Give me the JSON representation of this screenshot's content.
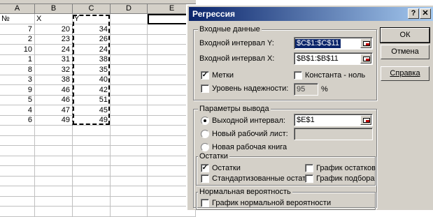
{
  "sheet": {
    "columns": [
      "A",
      "B",
      "C",
      "D",
      "E"
    ],
    "headers": {
      "a": "№",
      "b": "X",
      "c": "Y"
    },
    "rows": [
      [
        "7",
        "20",
        "34"
      ],
      [
        "2",
        "23",
        "26"
      ],
      [
        "10",
        "24",
        "24"
      ],
      [
        "1",
        "31",
        "38"
      ],
      [
        "8",
        "32",
        "35"
      ],
      [
        "3",
        "38",
        "40"
      ],
      [
        "9",
        "46",
        "42"
      ],
      [
        "5",
        "46",
        "51"
      ],
      [
        "4",
        "47",
        "45"
      ],
      [
        "6",
        "49",
        "49"
      ]
    ]
  },
  "dialog": {
    "title": "Регрессия",
    "help_btn": "?",
    "close_btn": "✕",
    "input_group": "Входные данные",
    "y_range_label": "Входной интервал Y:",
    "y_range_value": "$C$1:$C$11",
    "x_range_label": "Входной интервал X:",
    "x_range_value": "$B$1:$B$11",
    "labels_check": "Метки",
    "labels_checked": true,
    "const_check": "Константа - ноль",
    "const_checked": false,
    "confidence_check": "Уровень надежности:",
    "confidence_checked": false,
    "confidence_value": "95",
    "percent_sign": "%",
    "output_group": "Параметры вывода",
    "out_range_label": "Выходной интервал:",
    "out_range_value": "$E$1",
    "new_sheet_label": "Новый рабочий лист:",
    "new_book_label": "Новая рабочая книга",
    "selected_output": "out_range",
    "residuals_group": "Остатки",
    "residuals_check": "Остатки",
    "residuals_checked": true,
    "std_residuals_check": "Стандартизованные остатки",
    "residual_plot_check": "График остатков",
    "fit_plot_check": "График подбора",
    "normal_group": "Нормальная вероятность",
    "normal_plot_check": "График нормальной вероятности",
    "ok_btn": "ОК",
    "cancel_btn": "Отмена",
    "help_btn_label": "Справка"
  },
  "colors": {
    "title_active": "#0a246a",
    "face": "#d4d0c8",
    "selection": "#0a246a"
  }
}
